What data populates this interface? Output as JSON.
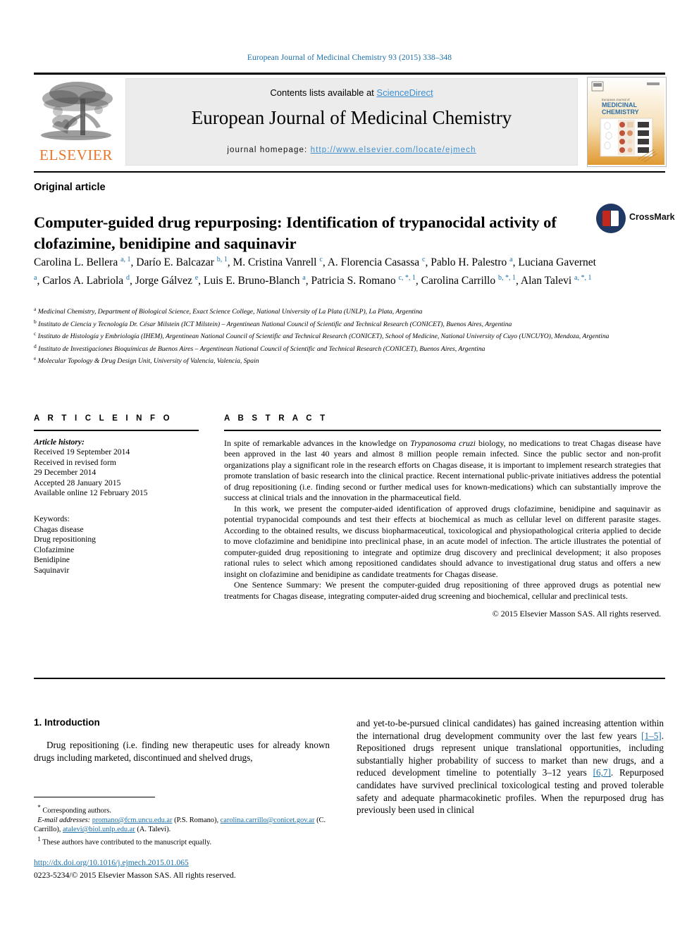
{
  "running_head": "European Journal of Medicinal Chemistry 93 (2015) 338–348",
  "masthead": {
    "contents_prefix": "Contents lists available at ",
    "sciencedirect": "ScienceDirect",
    "journal_title": "European Journal of Medicinal Chemistry",
    "homepage_label": "journal homepage:",
    "homepage_url": "http://www.elsevier.com/locate/ejmech",
    "publisher_wordmark": "ELSEVIER",
    "publisher_logo_icon": "elsevier-tree-icon",
    "cover_icon": "journal-cover-thumbnail",
    "cover_title_line1": "European Journal of",
    "cover_title_line2": "MEDICINAL",
    "cover_title_line3": "CHEMISTRY"
  },
  "article": {
    "kind": "Original article",
    "title": "Computer-guided drug repurposing: Identification of trypanocidal activity of clofazimine, benidipine and saquinavir",
    "crossmark_label": "CrossMark",
    "crossmark_icon": "crossmark-badge-icon",
    "authors_html": "Carolina L. Bellera <sup>a, 1</sup>, Darío E. Balcazar <sup>b, 1</sup>, M. Cristina Vanrell <sup>c</sup>, A. Florencia Casassa <sup>c</sup>, Pablo H. Palestro <sup>a</sup>, Luciana Gavernet <sup>a</sup>, Carlos A. Labriola <sup>d</sup>, Jorge Gálvez <sup>e</sup>, Luis E. Bruno-Blanch <sup>a</sup>, Patricia S. Romano <sup>c, *, 1</sup>, Carolina Carrillo <sup>b, *, 1</sup>, Alan Talevi <sup>a, *, 1</sup>",
    "affiliations": [
      {
        "mark": "a",
        "text": "Medicinal Chemistry, Department of Biological Science, Exact Science College, National University of La Plata (UNLP), La Plata, Argentina"
      },
      {
        "mark": "b",
        "text": "Instituto de Ciencia y Tecnología Dr. César Milstein (ICT Milstein) – Argentinean National Council of Scientific and Technical Research (CONICET), Buenos Aires, Argentina"
      },
      {
        "mark": "c",
        "text": "Instituto de Histología y Embriología (IHEM), Argentinean National Council of Scientific and Technical Research (CONICET), School of Medicine, National University of Cuyo (UNCUYO), Mendoza, Argentina"
      },
      {
        "mark": "d",
        "text": "Instituto de Investigaciones Bioquímicas de Buenos Aires – Argentinean National Council of Scientific and Technical Research (CONICET), Buenos Aires, Argentina"
      },
      {
        "mark": "e",
        "text": "Molecular Topology & Drug Design Unit, University of Valencia, Valencia, Spain"
      }
    ]
  },
  "article_info": {
    "heading": "A R T I C L E  I N F O",
    "history_label": "Article history:",
    "history": [
      "Received 19 September 2014",
      "Received in revised form",
      "29 December 2014",
      "Accepted 28 January 2015",
      "Available online 12 February 2015"
    ],
    "keywords_label": "Keywords:",
    "keywords": [
      "Chagas disease",
      "Drug repositioning",
      "Clofazimine",
      "Benidipine",
      "Saquinavir"
    ]
  },
  "abstract": {
    "heading": "A B S T R A C T",
    "paragraph1_pre": "In spite of remarkable advances in the knowledge on ",
    "paragraph1_italic": "Trypanosoma cruzi",
    "paragraph1_post": " biology, no medications to treat Chagas disease have been approved in the last 40 years and almost 8 million people remain infected. Since the public sector and non-profit organizations play a significant role in the research efforts on Chagas disease, it is important to implement research strategies that promote translation of basic research into the clinical practice. Recent international public-private initiatives address the potential of drug repositioning (i.e. finding second or further medical uses for known-medications) which can substantially improve the success at clinical trials and the innovation in the pharmaceutical field.",
    "paragraph2": "In this work, we present the computer-aided identification of approved drugs clofazimine, benidipine and saquinavir as potential trypanocidal compounds and test their effects at biochemical as much as cellular level on different parasite stages. According to the obtained results, we discuss biopharmaceutical, toxicological and physiopathological criteria applied to decide to move clofazimine and benidipine into preclinical phase, in an acute model of infection. The article illustrates the potential of computer-guided drug repositioning to integrate and optimize drug discovery and preclinical development; it also proposes rational rules to select which among repositioned candidates should advance to investigational drug status and offers a new insight on clofazimine and benidipine as candidate treatments for Chagas disease.",
    "paragraph3": "One Sentence Summary: We present the computer-guided drug repositioning of three approved drugs as potential new treatments for Chagas disease, integrating computer-aided drug screening and biochemical, cellular and preclinical tests.",
    "copyright": "© 2015 Elsevier Masson SAS. All rights reserved."
  },
  "body": {
    "section_heading": "1. Introduction",
    "left_paragraph": "Drug repositioning (i.e. finding new therapeutic uses for already known drugs including marketed, discontinued and shelved drugs,",
    "right_paragraph_part1": "and yet-to-be-pursued clinical candidates) has gained increasing attention within the international drug development community over the last few years ",
    "right_ref1": "[1–5]",
    "right_paragraph_part2": ". Repositioned drugs represent unique translational opportunities, including substantially higher probability of success to market than new drugs, and a reduced development timeline to potentially 3–12 years ",
    "right_ref2": "[6,7]",
    "right_paragraph_part3": ". Repurposed candidates have survived preclinical toxicological testing and proved tolerable safety and adequate pharmacokinetic profiles. When the repurposed drug has previously been used in clinical"
  },
  "footnotes": {
    "corresponding_mark": "*",
    "corresponding_text": "Corresponding authors.",
    "email_label": "E-mail addresses:",
    "emails": [
      {
        "address": "promano@fcm.uncu.edu.ar",
        "owner": "(P.S. Romano)"
      },
      {
        "address": "carolina.carrillo@conicet.gov.ar",
        "owner": "(C. Carrillo)"
      },
      {
        "address": "atalevi@biol.unlp.edu.ar",
        "owner": "(A. Talevi)"
      }
    ],
    "equal_contrib_mark": "1",
    "equal_contrib_text": "These authors have contributed to the manuscript equally.",
    "doi": "http://dx.doi.org/10.1016/j.ejmech.2015.01.065",
    "issn_line": "0223-5234/© 2015 Elsevier Masson SAS. All rights reserved."
  },
  "colors": {
    "link_blue": "#1a6ea8",
    "sciencedirect_blue": "#3d8fd1",
    "elsevier_orange": "#E8762A",
    "crossmark_navy": "#1f3864",
    "crossmark_red": "#c3281c",
    "band_gray": "#ececec"
  }
}
